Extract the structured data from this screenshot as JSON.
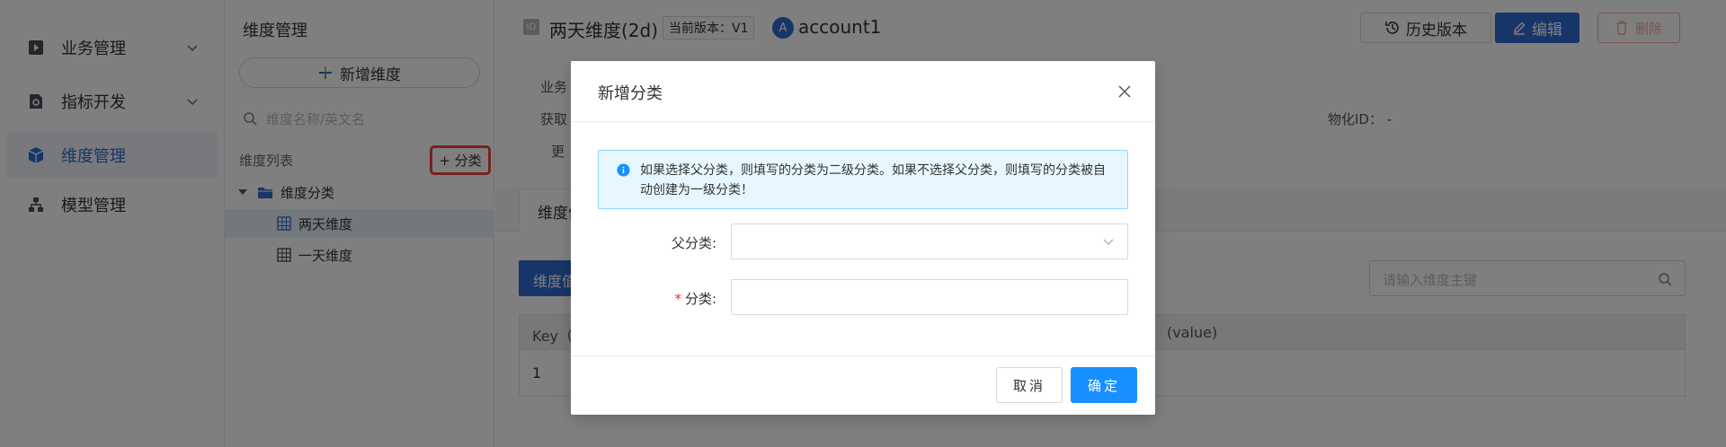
{
  "nav": {
    "items": [
      {
        "label": "业务管理",
        "icon": "play-square-icon",
        "expandable": true
      },
      {
        "label": "指标开发",
        "icon": "gear-file-icon",
        "expandable": true
      },
      {
        "label": "维度管理",
        "icon": "cube-icon",
        "active": true
      },
      {
        "label": "模型管理",
        "icon": "org-chart-icon"
      }
    ]
  },
  "tree": {
    "title": "维度管理",
    "add_button": "新增维度",
    "search_placeholder": "维度名称/英文名",
    "list_label": "维度列表",
    "add_category_button": "+ 分类",
    "nodes": [
      {
        "label": "维度分类",
        "type": "folder"
      },
      {
        "label": "两天维度",
        "type": "table",
        "selected": true
      },
      {
        "label": "一天维度",
        "type": "table"
      }
    ]
  },
  "header": {
    "id_badge": "ID",
    "title": "两天维度(2d)",
    "version": "当前版本：V1",
    "avatar_letter": "A",
    "account": "account1",
    "history_button": "历史版本",
    "edit_button": "编辑",
    "delete_button": "删除"
  },
  "meta": {
    "biz_label": "业务",
    "fetch_label": "获取",
    "partial": "更",
    "physical_id": "物化ID：  -"
  },
  "content": {
    "tab_label": "维度值",
    "blue_button": "维度值",
    "search_placeholder": "请输入维度主键",
    "table_headers": [
      "Key（",
      "(value)"
    ],
    "rows": [
      [
        "1"
      ]
    ]
  },
  "modal": {
    "title": "新增分类",
    "alert": "如果选择父分类，则填写的分类为二级分类。如果不选择父分类，则填写的分类被自动创建为一级分类！",
    "parent_label": "父分类:",
    "category_label": "分类:",
    "required_mark": "*",
    "parent_value": "",
    "category_value": "",
    "cancel_button": "取消",
    "ok_button": "确定"
  },
  "colors": {
    "primary": "#1890ff",
    "brand": "#2f6ad1",
    "danger": "#f5222d",
    "highlight_border": "#e8483b"
  }
}
